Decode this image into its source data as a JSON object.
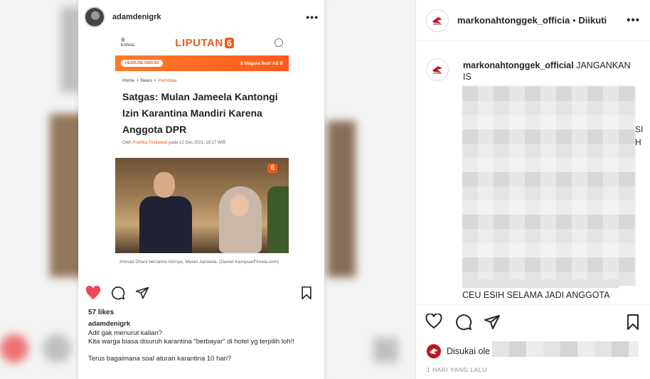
{
  "left_post": {
    "username": "adamdenigrk",
    "more": "•••",
    "article": {
      "kanal_label": "KANAL",
      "logo_text": "LIPUTAN",
      "logo_six": "6",
      "headline_pill": "HEADLINE HARI INI",
      "headline_text": "6 Negara Ikuti AS B",
      "crumbs": [
        "Home",
        "News",
        "Peristiwa"
      ],
      "crumb_sep": "•",
      "title": "Satgas: Mulan Jameela Kantongi Izin Karantina Mandiri Karena Anggota DPR",
      "byline_prefix": "Oleh",
      "byline_author": "Pramita Tristiawati",
      "byline_suffix": "pada 12 Des 2021, 19:17 WIB",
      "photo_badge": "6",
      "photo_caption": "Ahmad Dhani bersama istrinya, Mulan Jameela. (Daniel Kampua/Fimela.com)"
    },
    "likes": "57 likes",
    "caption_user": "adamdenigrk",
    "caption_lines": [
      "Adil gak menurut kalian?",
      "Kita warga biasa disuruh karantina \"berbayar\" di hotel yg terpilih loh!!",
      "",
      "Terus bagaimana soal aturan karantina 10 hari?"
    ]
  },
  "right_panel": {
    "username": "markonahtonggek_officia",
    "dot": "•",
    "follow_label": "Diikuti",
    "more": "•••",
    "comment_user": "markonahtonggek_official",
    "comment_start": "JANGANKAN",
    "comment_line2": "IS",
    "fragment_right": "SI\nH",
    "comment_end": "CEU ESIH SELAMA JADI ANGGOTA",
    "liked_prefix": "Disukai ole",
    "time": "1 HARI YANG LALU"
  },
  "colors": {
    "like_red": "#ed4956",
    "liputan_orange": "#f05a1a",
    "text": "#262626",
    "muted": "#8e8e8e"
  },
  "icons": [
    "heart-icon",
    "comment-icon",
    "share-icon",
    "bookmark-icon",
    "more-icon"
  ]
}
